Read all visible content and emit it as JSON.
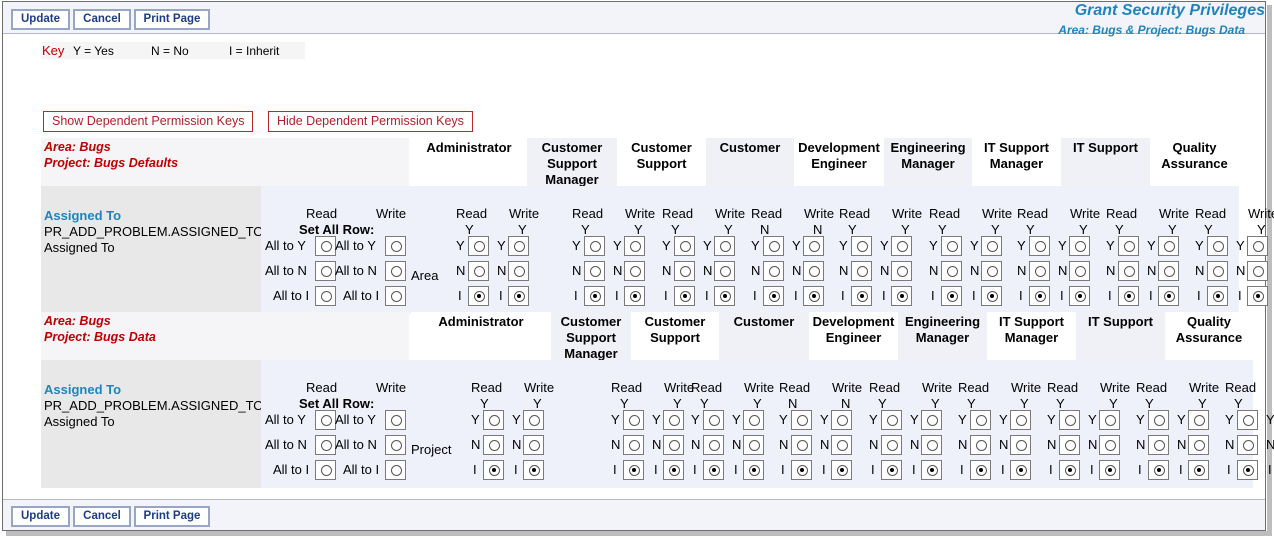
{
  "toolbar": {
    "update": "Update",
    "cancel": "Cancel",
    "print": "Print Page"
  },
  "header": {
    "title": "Grant Security Privileges",
    "subtitle": "Area: Bugs & Project: Bugs Data"
  },
  "key": {
    "label": "Key",
    "yes": "Y = Yes",
    "no": "N = No",
    "inherit": "I = Inherit"
  },
  "actions": {
    "show": "Show Dependent Permission Keys",
    "hide": "Hide Dependent Permission Keys"
  },
  "roles": [
    "Administrator",
    "Customer Support Manager",
    "Customer Support",
    "Customer",
    "Development Engineer",
    "Engineering Manager",
    "IT Support Manager",
    "IT Support",
    "Quality Assurance"
  ],
  "grid": {
    "assigned_to": "Assigned To",
    "permission": "PR_ADD_PROBLEM.ASSIGNED_TO",
    "assigned_sub": "Assigned To",
    "read": "Read",
    "write": "Write",
    "set_all_row": "Set All Row:",
    "all_y": "All to Y",
    "all_n": "All to N",
    "all_i": "All to I",
    "Y": "Y",
    "N": "N",
    "I": "I"
  },
  "sections": [
    {
      "area": "Area: Bugs",
      "project": "Project: Bugs Defaults",
      "row_label": "Area",
      "values": [
        [
          "Y",
          "Y"
        ],
        [
          "Y",
          "Y"
        ],
        [
          "Y",
          "Y"
        ],
        [
          "N",
          "N"
        ],
        [
          "Y",
          "Y"
        ],
        [
          "Y",
          "Y"
        ],
        [
          "Y",
          "Y"
        ],
        [
          "Y",
          "Y"
        ],
        [
          "Y",
          "Y"
        ]
      ]
    },
    {
      "area": "Area: Bugs",
      "project": "Project: Bugs Data",
      "row_label": "Project",
      "values": [
        [
          "Y",
          "Y"
        ],
        [
          "Y",
          "Y"
        ],
        [
          "Y",
          "Y"
        ],
        [
          "N",
          "N"
        ],
        [
          "Y",
          "Y"
        ],
        [
          "Y",
          "Y"
        ],
        [
          "Y",
          "Y"
        ],
        [
          "Y",
          "Y"
        ],
        [
          "Y",
          "Y"
        ]
      ]
    }
  ]
}
